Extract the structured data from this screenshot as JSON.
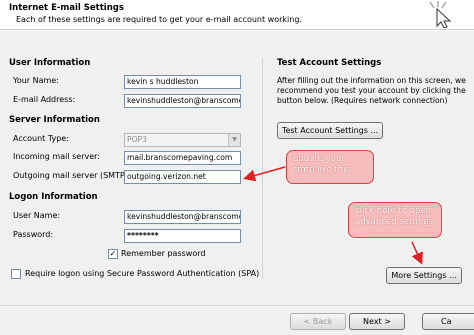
{
  "header": {
    "title": "Internet E-mail Settings",
    "subtitle": "Each of these settings are required to get your e-mail account working."
  },
  "user_info": {
    "title": "User Information",
    "name_label": "Your Name:",
    "name_value": "kevin s huddleston",
    "email_label": "E-mail Address:",
    "email_value": "kevinshuddleston@branscome"
  },
  "server_info": {
    "title": "Server Information",
    "account_type_label": "Account Type:",
    "account_type_value": "POP3",
    "incoming_label": "Incoming mail server:",
    "incoming_value": "mail.branscomepaving.com",
    "outgoing_label": "Outgoing mail server (SMTP):",
    "outgoing_value": "outgoing.verizon.net"
  },
  "logon_info": {
    "title": "Logon Information",
    "username_label": "User Name:",
    "username_value": "kevinshuddleston@branscome",
    "password_label": "Password:",
    "password_value": "********",
    "remember_label": "Remember password",
    "remember_checked": true,
    "spa_label": "Require logon using Secure Password Authentication (SPA)",
    "spa_checked": false
  },
  "test_account": {
    "title": "Test Account Settings",
    "description_1": "After filling out the information on this screen, we",
    "description_2": "recommend you test your account by clicking the",
    "description_3": "button below. (Requires network connection)",
    "button_label": "Test Account Settings ..."
  },
  "more_settings_label": "More Settings ...",
  "footer": {
    "back_label": "< Back",
    "next_label": "Next >",
    "cancel_label": "Ca"
  },
  "annotations": {
    "callout_smtp_1": "update your",
    "callout_smtp_2": "smtp like this",
    "callout_adv_1": "click here to open",
    "callout_adv_2": "advanced settings"
  },
  "colors": {
    "callout_fill": "#f6bcbc",
    "callout_border": "#d64545",
    "arrow": "#e02020"
  }
}
